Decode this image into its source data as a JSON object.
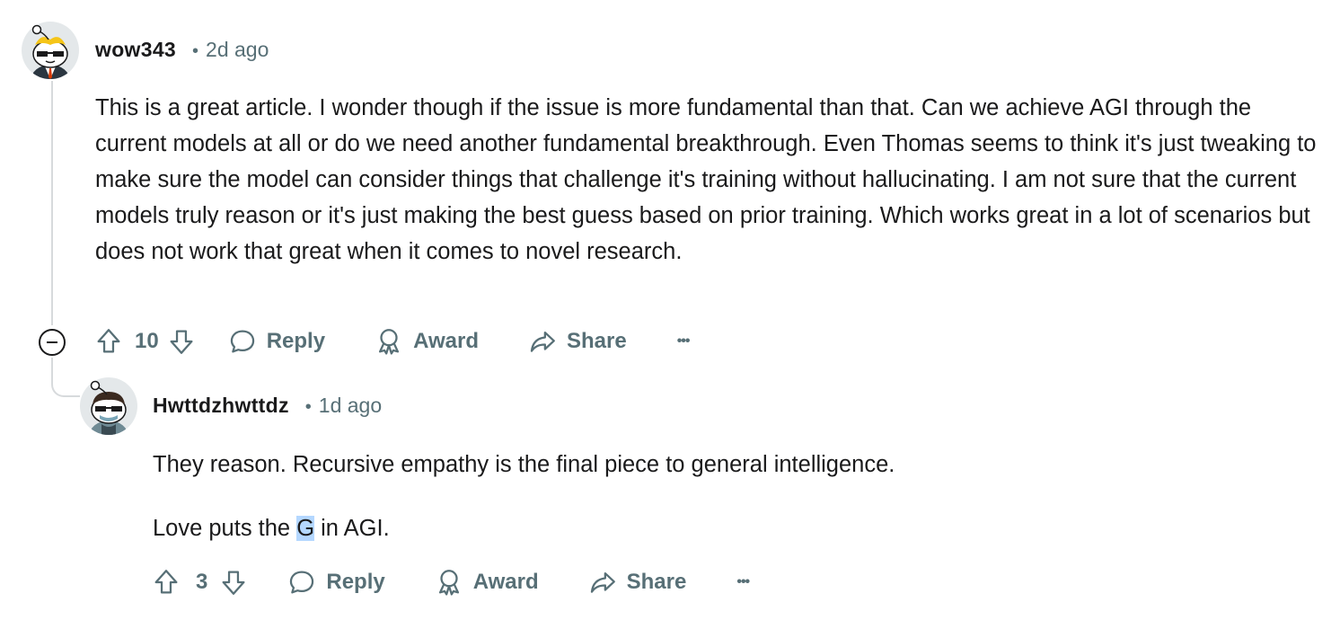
{
  "comments": [
    {
      "username": "wow343",
      "separator": "•",
      "time": "2d ago",
      "body": [
        "This is a great article. I wonder though if the issue is more fundamental than that. Can we achieve AGI through the current models at all or do we need another fundamental breakthrough. Even Thomas seems to think it's just tweaking to make sure the model can consider things that challenge it's training without hallucinating. I am not sure that the current models truly reason or it's just making the best guess based on prior training. Which works great in a lot of scenarios but does not work that great when it comes to novel research."
      ],
      "votes": "10",
      "actions": {
        "reply": "Reply",
        "award": "Award",
        "share": "Share",
        "more": "•••"
      }
    },
    {
      "username": "Hwttdzhwttdz",
      "separator": "•",
      "time": "1d ago",
      "body_line1": "They reason. Recursive empathy is the final piece to general intelligence.",
      "body_line2_before": "Love puts the ",
      "body_line2_selected": "G",
      "body_line2_after": " in AGI.",
      "votes": "3",
      "actions": {
        "reply": "Reply",
        "award": "Award",
        "share": "Share",
        "more": "•••"
      }
    }
  ]
}
